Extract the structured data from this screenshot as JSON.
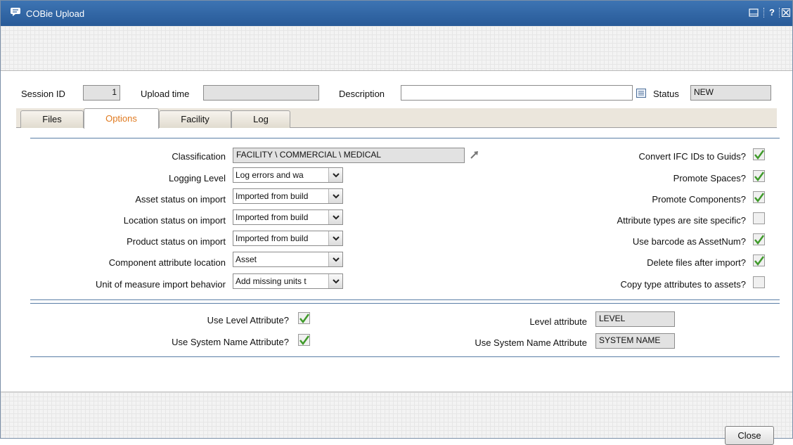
{
  "window": {
    "title": "COBie Upload",
    "help_label": "?"
  },
  "header": {
    "session_label": "Session ID",
    "session_value": "1",
    "upload_label": "Upload time",
    "upload_value": "",
    "description_label": "Description",
    "description_value": "",
    "status_label": "Status",
    "status_value": "NEW"
  },
  "tabs": [
    {
      "label": "Files",
      "active": false
    },
    {
      "label": "Options",
      "active": true
    },
    {
      "label": "Facility",
      "active": false
    },
    {
      "label": "Log",
      "active": false
    }
  ],
  "options_left": {
    "classification": {
      "label": "Classification",
      "value": "FACILITY \\ COMMERCIAL \\ MEDICAL"
    },
    "logging_level": {
      "label": "Logging Level",
      "value": "Log errors and wa"
    },
    "asset_status": {
      "label": "Asset status on import",
      "value": "Imported from build"
    },
    "location_status": {
      "label": "Location status on import",
      "value": "Imported from build"
    },
    "product_status": {
      "label": "Product status on import",
      "value": "Imported from build"
    },
    "component_location": {
      "label": "Component attribute location",
      "value": "Asset"
    },
    "unit_behavior": {
      "label": "Unit of measure import behavior",
      "value": "Add missing units t"
    }
  },
  "options_right": [
    {
      "label": "Convert IFC IDs to Guids?",
      "checked": true
    },
    {
      "label": "Promote Spaces?",
      "checked": true
    },
    {
      "label": "Promote Components?",
      "checked": true
    },
    {
      "label": "Attribute types are site specific?",
      "checked": false
    },
    {
      "label": "Use barcode as AssetNum?",
      "checked": true
    },
    {
      "label": "Delete files after import?",
      "checked": true
    },
    {
      "label": "Copy type attributes to assets?",
      "checked": false
    }
  ],
  "level_section": {
    "use_level_label": "Use Level Attribute?",
    "use_level_checked": true,
    "use_system_label": "Use System Name Attribute?",
    "use_system_checked": true,
    "level_attr_label": "Level attribute",
    "level_attr_value": "LEVEL",
    "system_attr_label": "Use System Name Attribute",
    "system_attr_value": "SYSTEM NAME"
  },
  "footer": {
    "close_label": "Close"
  },
  "colors": {
    "title_bar": "#2f64a4",
    "active_tab": "#e07a1f",
    "check": "#3f9a2a",
    "divider": "#5a7ea6"
  }
}
